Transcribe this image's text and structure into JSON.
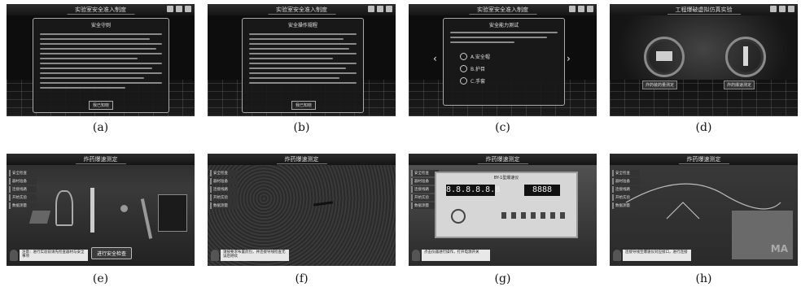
{
  "panels": [
    {
      "id": "a",
      "caption": "(a)",
      "title": "实验室安全准入制度",
      "dialog_title": "安全守则",
      "button": "我已知晓",
      "icons": [
        "settings-icon",
        "help-icon",
        "menu-icon"
      ]
    },
    {
      "id": "b",
      "caption": "(b)",
      "title": "实验室安全准入制度",
      "dialog_title": "安全操作规程",
      "button": "我已知晓",
      "icons": [
        "settings-icon",
        "help-icon",
        "menu-icon"
      ]
    },
    {
      "id": "c",
      "caption": "(c)",
      "title": "实验室安全准入制度",
      "dialog_title": "安全能力测试",
      "options": [
        "A.安全帽",
        "B.护目",
        "C.手套"
      ]
    },
    {
      "id": "d",
      "caption": "(d)",
      "title": "工程爆破虚拟仿真实验",
      "left_label": "炸药装药量测定",
      "right_label": "炸药爆速测定"
    },
    {
      "id": "e",
      "caption": "(e)",
      "title": "炸药爆速测定",
      "menu": [
        "安全检查",
        "器材准备",
        "连接线路",
        "开始实验",
        "数据测量"
      ],
      "hint": "注意：进行实验前请先检查器材与安全事项",
      "button": "进行安全检查"
    },
    {
      "id": "f",
      "caption": "(f)",
      "title": "炸药爆速测定",
      "menu": [
        "安全检查",
        "器材准备",
        "连接线路",
        "开始实验",
        "数据测量"
      ],
      "hint": "请按要求布置药包，并连接导线检查无误后继续"
    },
    {
      "id": "g",
      "caption": "(g)",
      "title": "炸药爆速测定",
      "menu": [
        "安全检查",
        "器材准备",
        "连接线路",
        "开始实验",
        "数据测量"
      ],
      "device_name": "BY-1型爆速仪",
      "display_left": "8.8.8.8.8.8",
      "display_right": "8888",
      "hint": "点击仪器进行操作，打开电源开关"
    },
    {
      "id": "h",
      "caption": "(h)",
      "title": "炸药爆速测定",
      "menu": [
        "安全检查",
        "器材准备",
        "连接线路",
        "开始实验",
        "数据测量"
      ],
      "hint": "连接导线至爆速仪对应接口，进行连接",
      "label": "MA"
    }
  ]
}
